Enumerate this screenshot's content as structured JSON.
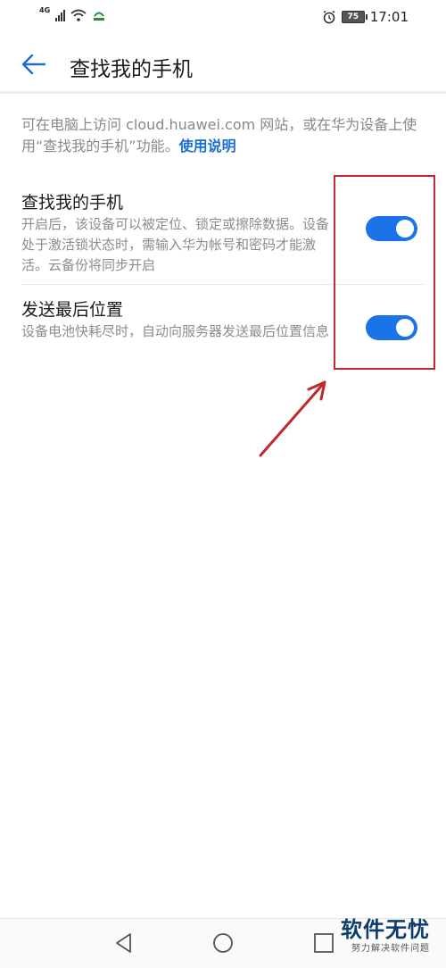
{
  "status_bar": {
    "network_label": "4G",
    "battery_level": "75",
    "time": "17:01"
  },
  "header": {
    "title": "查找我的手机"
  },
  "intro": {
    "text": "可在电脑上访问 cloud.huawei.com 网站，或在华为设备上使用“查找我的手机”功能。",
    "link_label": "使用说明"
  },
  "settings": [
    {
      "title": "查找我的手机",
      "description": "开启后，该设备可以被定位、锁定或擦除数据。设备处于激活锁状态时，需输入华为帐号和密码才能激活。云备份将同步开启",
      "enabled": true
    },
    {
      "title": "发送最后位置",
      "description": "设备电池快耗尽时，自动向服务器发送最后位置信息",
      "enabled": true
    }
  ],
  "colors": {
    "accent": "#1a73e8",
    "annotation": "#c0282d"
  },
  "watermark": {
    "title": "软件无忧",
    "subtitle": "努力解决软件问题"
  }
}
